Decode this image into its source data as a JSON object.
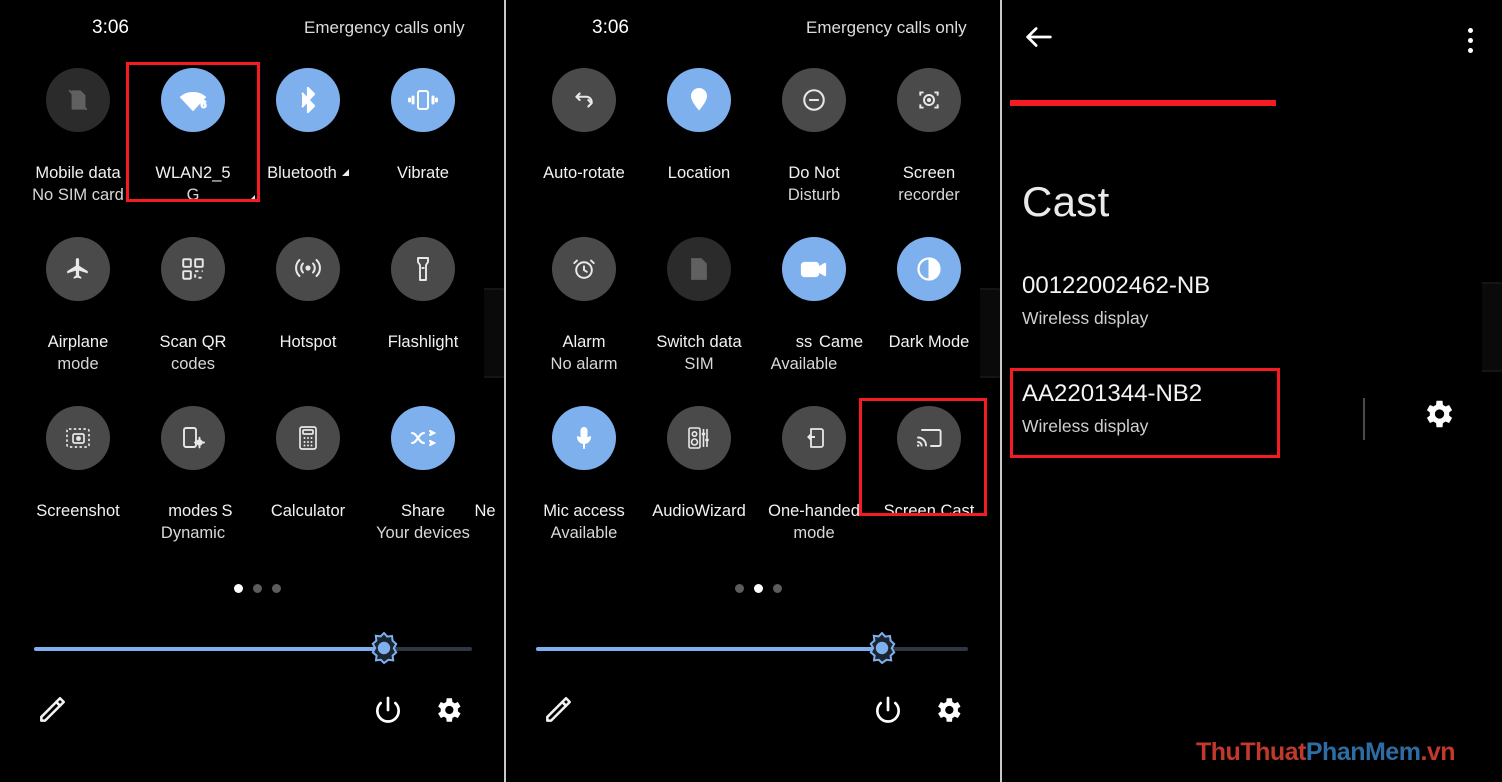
{
  "colors": {
    "accent_blue": "#7fb0ee",
    "tile_off": "#4a4a4a",
    "highlight_red": "#f51b23",
    "background": "#000000",
    "divider": "#c8c8c8"
  },
  "panel1": {
    "status": {
      "time": "3:06",
      "carrier": "Emergency calls only"
    },
    "tiles": [
      {
        "label": "Mobile data",
        "sub": "No SIM card",
        "state": "dim",
        "icon": "sim-card-off-icon",
        "caret": false
      },
      {
        "label": "WLAN2_5",
        "sub": "G",
        "state": "on",
        "icon": "wifi-6-icon",
        "caret": true,
        "badge": "6"
      },
      {
        "label": "Bluetooth",
        "sub": "",
        "state": "on",
        "icon": "bluetooth-icon",
        "caret": true
      },
      {
        "label": "Vibrate",
        "sub": "",
        "state": "on",
        "icon": "vibrate-icon",
        "caret": false
      },
      {
        "label": "Airplane",
        "sub": "mode",
        "state": "off",
        "icon": "airplane-icon",
        "caret": false
      },
      {
        "label": "Scan QR",
        "sub": "codes",
        "state": "off",
        "icon": "qr-code-icon",
        "caret": false
      },
      {
        "label": "Hotspot",
        "sub": "",
        "state": "off",
        "icon": "hotspot-icon",
        "caret": false
      },
      {
        "label": "Flashlight",
        "sub": "",
        "state": "off",
        "icon": "flashlight-icon",
        "caret": false
      },
      {
        "label": "Screenshot",
        "sub": "",
        "state": "off",
        "icon": "screenshot-icon",
        "caret": false
      },
      {
        "label": "modes",
        "sub": "Dynamic",
        "state": "off",
        "icon": "dynamic-modes-icon",
        "caret": false
      },
      {
        "label": "S",
        "sub": "",
        "state": "off",
        "icon": "calculator-icon",
        "caret": false
      },
      {
        "label": "Calculator",
        "sub": "",
        "state": "off",
        "icon": "calculator-icon",
        "caret": false
      },
      {
        "label": "Share",
        "sub": "Your devices",
        "state": "on",
        "icon": "share-shuffle-icon",
        "caret": false
      },
      {
        "label": "Ne",
        "sub": "",
        "state": "off",
        "icon": "nearby-icon",
        "caret": false
      }
    ],
    "pager": {
      "count": 3,
      "active": 0
    },
    "brightness": {
      "percent": 80
    },
    "bottom": {
      "edit_label": "edit-pencil",
      "power_label": "power",
      "settings_label": "settings"
    },
    "highlight": "WLAN2_5G"
  },
  "panel2": {
    "status": {
      "time": "3:06",
      "carrier": "Emergency calls only"
    },
    "tiles": [
      {
        "label": "Auto-rotate",
        "sub": "",
        "state": "off",
        "icon": "auto-rotate-icon"
      },
      {
        "label": "Location",
        "sub": "",
        "state": "on",
        "icon": "location-pin-icon"
      },
      {
        "label": "Do Not",
        "sub": "Disturb",
        "state": "off",
        "icon": "do-not-disturb-icon"
      },
      {
        "label": "Screen",
        "sub": "recorder",
        "state": "off",
        "icon": "screen-recorder-icon"
      },
      {
        "label": "Alarm",
        "sub": "No alarm",
        "state": "off",
        "icon": "alarm-clock-icon"
      },
      {
        "label": "Switch data",
        "sub": "SIM",
        "state": "dim",
        "icon": "sim-card-icon"
      },
      {
        "label": "ss",
        "sub": "Available",
        "state": "off",
        "icon": "access-icon"
      },
      {
        "label": "Came",
        "sub": "",
        "state": "on",
        "icon": "camera-video-icon"
      },
      {
        "label": "Dark Mode",
        "sub": "",
        "state": "on",
        "icon": "dark-mode-icon"
      },
      {
        "label": "Mic access",
        "sub": "Available",
        "state": "on",
        "icon": "microphone-icon"
      },
      {
        "label": "AudioWizard",
        "sub": "",
        "state": "off",
        "icon": "audio-wizard-icon"
      },
      {
        "label": "One-handed",
        "sub": "mode",
        "state": "off",
        "icon": "one-handed-mode-icon"
      },
      {
        "label": "Screen Cast",
        "sub": "",
        "state": "off",
        "icon": "screen-cast-icon"
      }
    ],
    "pager": {
      "count": 3,
      "active": 1
    },
    "brightness": {
      "percent": 80
    },
    "highlight": "Screen Cast"
  },
  "panel3": {
    "title": "Cast",
    "back_icon": "back-arrow-icon",
    "menu_icon": "overflow-menu-icon",
    "settings_icon": "gear-icon",
    "devices": [
      {
        "name": "00122002462-NB",
        "subtitle": "Wireless display",
        "highlighted": false
      },
      {
        "name": "AA2201344-NB2",
        "subtitle": "Wireless display",
        "highlighted": true
      }
    ]
  },
  "watermark": {
    "part1": "ThuThuat",
    "part2": "PhanMem",
    "part3": ".vn"
  }
}
